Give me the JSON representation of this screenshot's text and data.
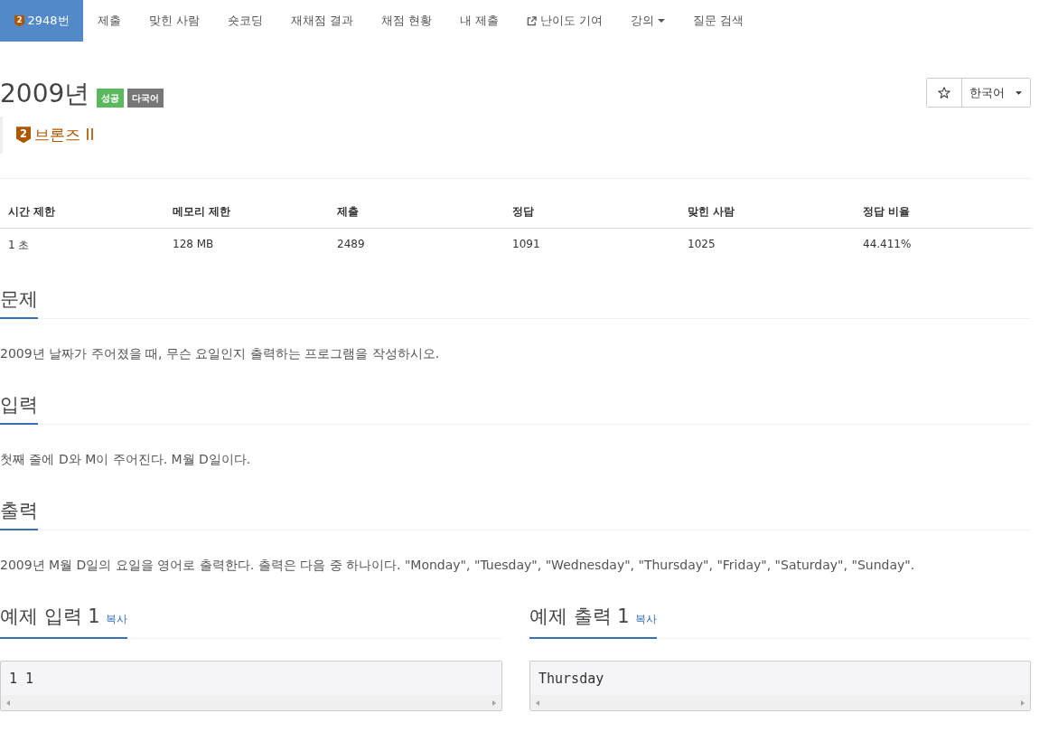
{
  "nav": {
    "items": [
      {
        "label": "2948번",
        "kind": "problem",
        "badge": "2",
        "selected": true
      },
      {
        "label": "제출",
        "kind": "link",
        "selected": false
      },
      {
        "label": "맞힌 사람",
        "kind": "link",
        "selected": false
      },
      {
        "label": "숏코딩",
        "kind": "link",
        "selected": false
      },
      {
        "label": "재채점 결과",
        "kind": "link",
        "selected": false
      },
      {
        "label": "채점 현황",
        "kind": "link",
        "selected": false
      },
      {
        "label": "내 제출",
        "kind": "link",
        "selected": false
      },
      {
        "label": "난이도 기여",
        "kind": "external",
        "selected": false
      },
      {
        "label": "강의",
        "kind": "dropdown",
        "selected": false
      },
      {
        "label": "질문 검색",
        "kind": "link",
        "selected": false
      }
    ]
  },
  "problem": {
    "title": "2009년",
    "labels": [
      {
        "text": "성공",
        "color": "#5cb85c"
      },
      {
        "text": "다국어",
        "color": "#777777"
      }
    ],
    "tier": {
      "badge": "2",
      "label": "브론즈 II"
    },
    "language": "한국어"
  },
  "table": {
    "columns": [
      "시간 제한",
      "메모리 제한",
      "제출",
      "정답",
      "맞힌 사람",
      "정답 비율"
    ],
    "rows": [
      [
        "1 초",
        "128 MB",
        "2489",
        "1091",
        "1025",
        "44.411%"
      ]
    ]
  },
  "sections": [
    {
      "title": "문제",
      "text": "2009년 날짜가 주어졌을 때, 무슨 요일인지 출력하는 프로그램을 작성하시오."
    },
    {
      "title": "입력",
      "text": "첫째 줄에 D와 M이 주어진다. M월 D일이다."
    },
    {
      "title": "출력",
      "text": "2009년 M월 D일의 요일을 영어로 출력한다. 출력은 다음 중 하나이다. \"Monday\", \"Tuesday\", \"Wednesday\", \"Thursday\", \"Friday\", \"Saturday\", \"Sunday\"."
    }
  ],
  "samples": [
    {
      "title": "예제 입력 1",
      "copy": "복사",
      "content": "1 1"
    },
    {
      "title": "예제 출력 1",
      "copy": "복사",
      "content": "Thursday"
    }
  ]
}
